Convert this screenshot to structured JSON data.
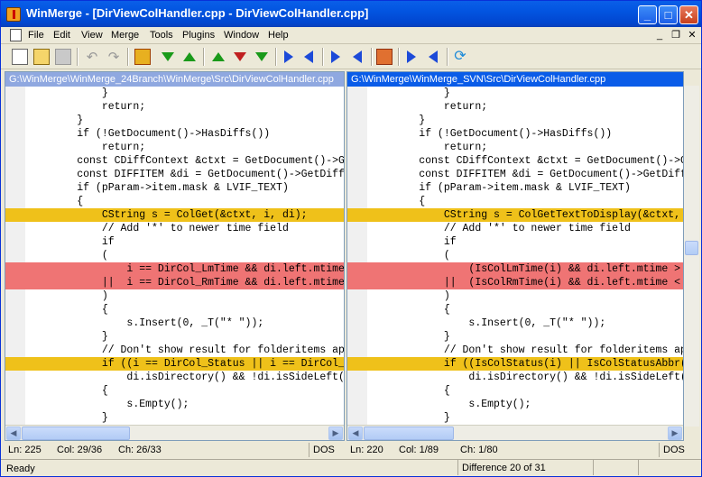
{
  "window": {
    "title": "WinMerge - [DirViewColHandler.cpp - DirViewColHandler.cpp]"
  },
  "menu": [
    "File",
    "Edit",
    "View",
    "Merge",
    "Tools",
    "Plugins",
    "Window",
    "Help"
  ],
  "left": {
    "path": "G:\\WinMerge\\WinMerge_24Branch\\WinMerge\\Src\\DirViewColHandler.cpp",
    "status": {
      "ln": "Ln: 225",
      "col": "Col: 29/36",
      "ch": "Ch: 26/33",
      "eol": "DOS"
    },
    "lines": [
      {
        "kind": "normal",
        "text": "            }"
      },
      {
        "kind": "normal",
        "text": "            return;"
      },
      {
        "kind": "normal",
        "text": "        }"
      },
      {
        "kind": "normal",
        "text": "        if (!GetDocument()->HasDiffs())"
      },
      {
        "kind": "normal",
        "text": "            return;"
      },
      {
        "kind": "normal",
        "text": "        const CDiffContext &ctxt = GetDocument()->GetD"
      },
      {
        "kind": "normal",
        "text": "        const DIFFITEM &di = GetDocument()->GetDiffRef"
      },
      {
        "kind": "normal",
        "text": "        if (pParam->item.mask & LVIF_TEXT)"
      },
      {
        "kind": "normal",
        "text": "        {"
      },
      {
        "kind": "diff",
        "text": "            CString s = ColGet(&ctxt, i, di);"
      },
      {
        "kind": "normal",
        "text": "            // Add '*' to newer time field"
      },
      {
        "kind": "normal",
        "text": "            if"
      },
      {
        "kind": "normal",
        "text": "            ("
      },
      {
        "kind": "del",
        "text": "                i == DirCol_LmTime && di.left.mtime > d"
      },
      {
        "kind": "del",
        "text": "            ||  i == DirCol_RmTime && di.left.mtime < d"
      },
      {
        "kind": "normal",
        "text": "            )"
      },
      {
        "kind": "normal",
        "text": "            {"
      },
      {
        "kind": "normal",
        "text": "                s.Insert(0, _T(\"* \"));"
      },
      {
        "kind": "normal",
        "text": "            }"
      },
      {
        "kind": "normal",
        "text": "            // Don't show result for folderitems appear"
      },
      {
        "kind": "diff",
        "text": "            if ((i == DirCol_Status || i == DirCol_Stat"
      },
      {
        "kind": "normal",
        "text": "                di.isDirectory() && !di.isSideLeft() &&"
      },
      {
        "kind": "normal",
        "text": "            {"
      },
      {
        "kind": "normal",
        "text": "                s.Empty();"
      },
      {
        "kind": "normal",
        "text": "            }"
      }
    ]
  },
  "right": {
    "path": "G:\\WinMerge\\WinMerge_SVN\\Src\\DirViewColHandler.cpp",
    "status": {
      "ln": "Ln: 220",
      "col": "Col: 1/89",
      "ch": "Ch: 1/80",
      "eol": "DOS"
    },
    "lines": [
      {
        "kind": "normal",
        "text": "            }"
      },
      {
        "kind": "normal",
        "text": "            return;"
      },
      {
        "kind": "normal",
        "text": "        }"
      },
      {
        "kind": "normal",
        "text": "        if (!GetDocument()->HasDiffs())"
      },
      {
        "kind": "normal",
        "text": "            return;"
      },
      {
        "kind": "normal",
        "text": "        const CDiffContext &ctxt = GetDocument()->GetD"
      },
      {
        "kind": "normal",
        "text": "        const DIFFITEM &di = GetDocument()->GetDiffRef"
      },
      {
        "kind": "normal",
        "text": "        if (pParam->item.mask & LVIF_TEXT)"
      },
      {
        "kind": "normal",
        "text": "        {"
      },
      {
        "kind": "diff",
        "text": "            CString s = ColGetTextToDisplay(&ctxt, i, d"
      },
      {
        "kind": "normal",
        "text": "            // Add '*' to newer time field"
      },
      {
        "kind": "normal",
        "text": "            if"
      },
      {
        "kind": "normal",
        "text": "            ("
      },
      {
        "kind": "del",
        "text": "                (IsColLmTime(i) && di.left.mtime > di.r"
      },
      {
        "kind": "del",
        "text": "            ||  (IsColRmTime(i) && di.left.mtime < di.r"
      },
      {
        "kind": "normal",
        "text": "            )"
      },
      {
        "kind": "normal",
        "text": "            {"
      },
      {
        "kind": "normal",
        "text": "                s.Insert(0, _T(\"* \"));"
      },
      {
        "kind": "normal",
        "text": "            }"
      },
      {
        "kind": "normal",
        "text": "            // Don't show result for folderitems appear"
      },
      {
        "kind": "diff",
        "text": "            if ((IsColStatus(i) || IsColStatusAbbr(i))"
      },
      {
        "kind": "normal",
        "text": "                di.isDirectory() && !di.isSideLeft() &&"
      },
      {
        "kind": "normal",
        "text": "            {"
      },
      {
        "kind": "normal",
        "text": "                s.Empty();"
      },
      {
        "kind": "normal",
        "text": "            }"
      }
    ]
  },
  "statusbar": {
    "left": "Ready",
    "diff": "Difference 20 of 31"
  },
  "colors": {
    "diff": "#efc11a",
    "moved": "#ef7474",
    "active_path": "#0a5ce8",
    "inactive_path": "#8fa8e0"
  }
}
